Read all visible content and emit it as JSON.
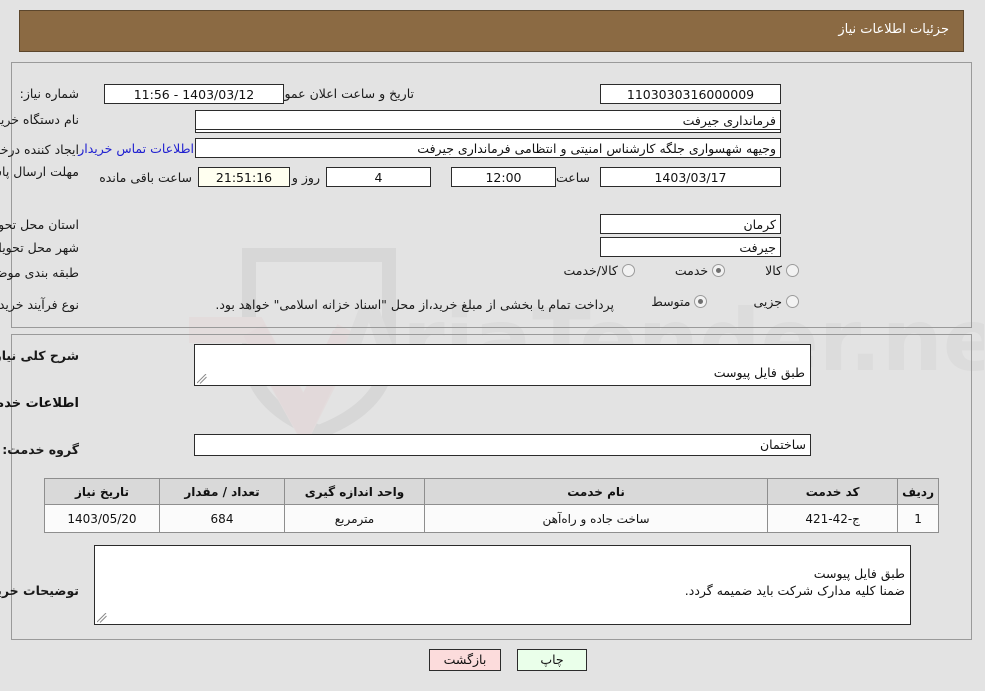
{
  "header": {
    "title": "جزئیات اطلاعات نیاز"
  },
  "top_section": {
    "need_number_label": "شماره نیاز:",
    "need_number_value": "1103030316000009",
    "announce_label": "تاریخ و ساعت اعلان عمومی:",
    "announce_value": "11:56 - 1403/03/12",
    "buyer_org_label": "نام دستگاه خریدار:",
    "buyer_org_value": "فرمانداری جیرفت",
    "buyer_org_value2": "",
    "creator_label": "ایجاد کننده درخواست:",
    "creator_value": "وجیهه شهسواری جلگه کارشناس امنیتی و انتظامی فرمانداری جیرفت",
    "contact_link": "اطلاعات تماس خریدار",
    "deadline_label": "مهلت ارسال پاسخ: تا تاریخ:",
    "deadline_date": "1403/03/17",
    "hour_label": "ساعت",
    "hour_value": "12:00",
    "days_value": "4",
    "days_label": "روز و",
    "countdown_value": "21:51:16",
    "remaining_label": "ساعت باقی مانده",
    "province_label": "استان محل تحویل:",
    "province_value": "کرمان",
    "city_label": "شهر محل تحویل:",
    "city_value": "جیرفت",
    "category_label": "طبقه بندی موضوعی:",
    "category_options": [
      {
        "label": "کالا",
        "selected": false
      },
      {
        "label": "خدمت",
        "selected": true
      },
      {
        "label": "کالا/خدمت",
        "selected": false
      }
    ],
    "process_label": "نوع فرآیند خرید :",
    "process_options": [
      {
        "label": "جزیی",
        "selected": false
      },
      {
        "label": "متوسط",
        "selected": true
      }
    ],
    "process_note": "پرداخت تمام یا بخشی از مبلغ خرید،از محل \"اسناد خزانه اسلامی\" خواهد بود."
  },
  "bottom_section": {
    "need_desc_label": "شرح کلی نیاز:",
    "need_desc_value": "طبق فایل پیوست",
    "services_heading": "اطلاعات خدمات مورد نیاز",
    "service_group_label": "گروه خدمت:",
    "service_group_value": "ساختمان",
    "buyer_notes_label": "توضیحات خریدار:",
    "buyer_notes_value": "طبق فایل پیوست\nضمنا کلیه مدارک شرکت باید ضمیمه گردد."
  },
  "table": {
    "headers": [
      "ردیف",
      "کد خدمت",
      "نام خدمت",
      "واحد اندازه گیری",
      "تعداد / مقدار",
      "تاریخ نیاز"
    ],
    "rows": [
      {
        "row": "1",
        "code": "ج-42-421",
        "name": "ساخت جاده و راه‌آهن",
        "unit": "مترمربع",
        "quantity": "684",
        "date": "1403/05/20"
      }
    ]
  },
  "footer": {
    "print_label": "چاپ",
    "back_label": "بازگشت"
  },
  "colors": {
    "header_bg": "#8b6a43",
    "page_bg": "#e3e3e3",
    "link": "#2020d0",
    "countdown_bg": "#fffff0",
    "print_bg": "#eaffea",
    "back_bg": "#fcdcdc",
    "table_header_bg": "#d9d9d9"
  },
  "watermark": {
    "text": "AriaTender.net"
  }
}
